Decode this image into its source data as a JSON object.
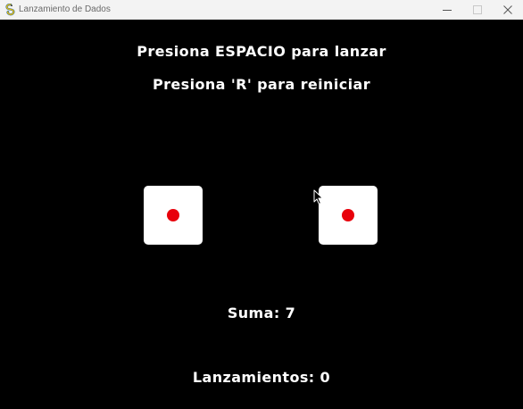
{
  "window": {
    "title": "Lanzamiento de Dados",
    "icon": "pygame-snake-icon",
    "controls": [
      "minimize-icon",
      "maximize-icon",
      "close-icon"
    ]
  },
  "game": {
    "instruction_roll": "Presiona ESPACIO para lanzar",
    "instruction_reset": "Presiona 'R' para reiniciar",
    "dice": [
      {
        "value": 1
      },
      {
        "value": 1
      }
    ],
    "sum_text": "Suma: 7",
    "rolls_text": "Lanzamientos: 0"
  },
  "colors": {
    "background": "#000000",
    "text": "#ffffff",
    "die_face": "#ffffff",
    "pip": "#e8000b"
  }
}
